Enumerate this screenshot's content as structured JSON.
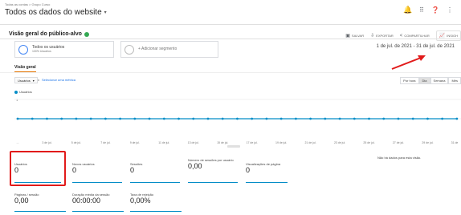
{
  "header": {
    "breadcrumb": "Todas as contas > Grupo Curso",
    "property": "Todos os dados do website",
    "icons": [
      "notifications-icon",
      "apps-icon",
      "help-icon",
      "more-icon"
    ]
  },
  "report": {
    "title": "Visão geral do público-alvo",
    "actions": [
      {
        "icon": "save-icon",
        "label": "SALVAR"
      },
      {
        "icon": "export-icon",
        "label": "EXPORTAR"
      },
      {
        "icon": "share-icon",
        "label": "COMPARTILHAR"
      },
      {
        "icon": "insights-icon",
        "label": "INSIGH"
      }
    ]
  },
  "segments": {
    "active": {
      "title": "Todos os usuários",
      "subtitle": "100% Usuários"
    },
    "add": "+ Adicionar segmento"
  },
  "date_range": "1 de jul. de 2021 - 31 de jul. de 2021",
  "tab": "Visão geral",
  "chart_controls": {
    "metric": "Usuários",
    "vs": "x",
    "select_metric": "Selecionar uma métrica",
    "granularity": [
      "Por hora",
      "Dia",
      "Semana",
      "Mês"
    ],
    "active_granularity": "Dia"
  },
  "legend": "Usuários",
  "colors": {
    "series": "#058dc7",
    "highlight": "#e11b1b",
    "accent": "#e37400"
  },
  "chart_data": {
    "type": "line",
    "x": [
      "...",
      "3 de jul.",
      "5 de jul.",
      "7 de jul.",
      "9 de jul.",
      "11 de jul.",
      "13 de jul.",
      "15 de jul.",
      "17 de jul.",
      "19 de jul.",
      "21 de jul.",
      "23 de jul.",
      "25 de jul.",
      "27 de jul.",
      "29 de jul.",
      "31 de"
    ],
    "y_ticks": [
      "1"
    ],
    "series": [
      {
        "name": "Usuários",
        "values": [
          0,
          0,
          0,
          0,
          0,
          0,
          0,
          0,
          0,
          0,
          0,
          0,
          0,
          0,
          0,
          0,
          0,
          0,
          0,
          0,
          0,
          0,
          0,
          0,
          0,
          0,
          0,
          0,
          0,
          0,
          0
        ]
      }
    ],
    "ylim": [
      0,
      1
    ],
    "grid": true
  },
  "metrics": [
    {
      "label": "Usuários",
      "value": "0"
    },
    {
      "label": "Novos usuários",
      "value": "0"
    },
    {
      "label": "Sessões",
      "value": "0"
    },
    {
      "label": "Número de sessões por usuário",
      "value": "0,00"
    },
    {
      "label": "Visualizações de página",
      "value": "0"
    },
    {
      "label": "Páginas / sessão",
      "value": "0,00"
    },
    {
      "label": "Duração média da sessão",
      "value": "00:00:00"
    },
    {
      "label": "Taxa de rejeição",
      "value": "0,00%"
    }
  ],
  "no_data": "Não há dados para esta visão."
}
